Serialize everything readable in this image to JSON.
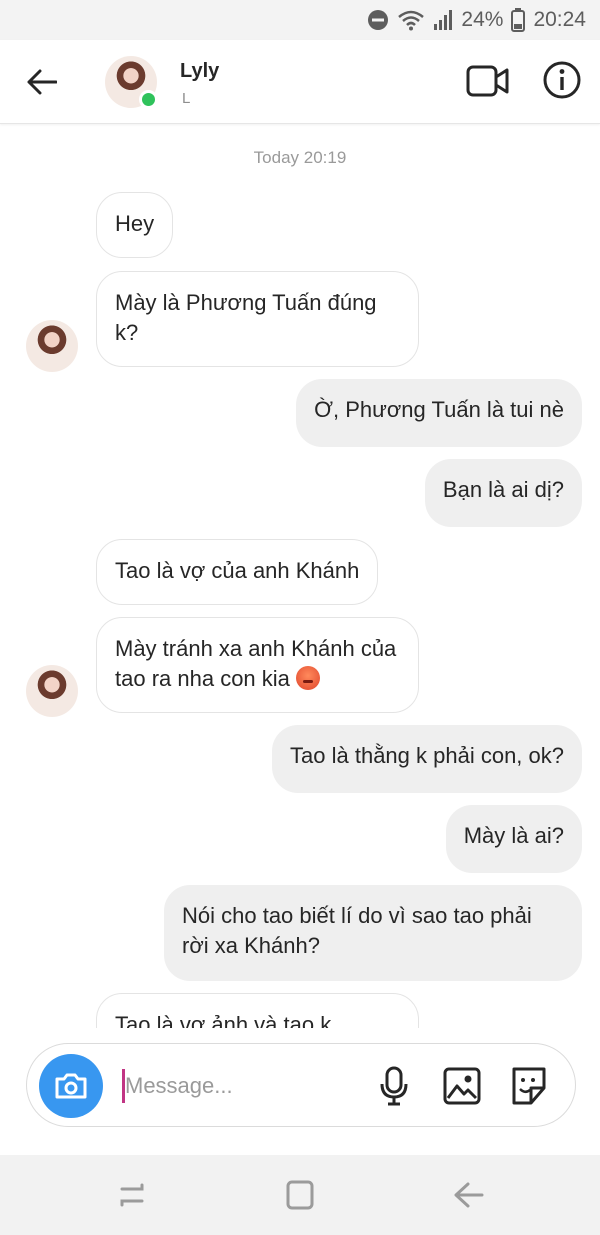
{
  "status_bar": {
    "battery_percent": "24%",
    "time": "20:24",
    "icons": [
      "do-not-disturb-icon",
      "wifi-icon",
      "signal-icon",
      "battery-icon"
    ]
  },
  "header": {
    "contact_name": "Lyly",
    "contact_subtitle": "L",
    "online": true,
    "icons": [
      "back-arrow-icon",
      "video-camera-icon",
      "info-icon"
    ]
  },
  "chat": {
    "timestamp": "Today 20:19",
    "messages": [
      {
        "direction": "in",
        "text": "Hey"
      },
      {
        "direction": "in",
        "text": "Mày là Phương Tuấn đúng k?"
      },
      {
        "direction": "out",
        "text": "Ờ, Phương Tuấn là tui nè"
      },
      {
        "direction": "out",
        "text": "Bạn là ai dị?"
      },
      {
        "direction": "in",
        "text": "Tao là vợ của anh Khánh"
      },
      {
        "direction": "in",
        "text": "Mày tránh xa anh Khánh của tao ra nha con kia",
        "emoji": "angry-face-emoji"
      },
      {
        "direction": "out",
        "text": "Tao là thằng k phải con, ok?"
      },
      {
        "direction": "out",
        "text": "Mày là ai?"
      },
      {
        "direction": "out",
        "text": "Nói cho tao biết lí do vì sao tao phải rời xa Khánh?"
      },
      {
        "direction": "in",
        "text": "Tao là vợ ảnh và tao k"
      }
    ]
  },
  "composer": {
    "placeholder": "Message...",
    "value": "",
    "icons": [
      "camera-icon",
      "microphone-icon",
      "gallery-icon",
      "sticker-icon"
    ]
  },
  "nav_bar": {
    "icons": [
      "recent-apps-icon",
      "home-icon",
      "back-icon"
    ]
  },
  "colors": {
    "accent_blue": "#3897f0",
    "online_green": "#2fc25b",
    "outgoing_bubble": "#efefef",
    "incoming_border": "#e4e4e4"
  }
}
